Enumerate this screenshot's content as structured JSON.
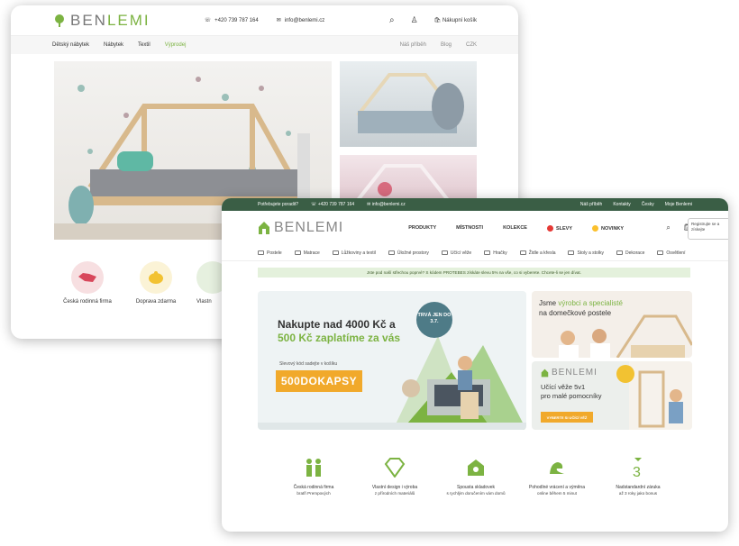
{
  "old_site": {
    "logo": {
      "prefix": "BEN",
      "suffix": "LEMI"
    },
    "phone": "+420 739 787 164",
    "email": "info@benlemi.cz",
    "cart_label": "Nákupní košík",
    "nav": [
      "Dětský nábytek",
      "Nábytek",
      "Textil",
      "Výprodej"
    ],
    "nav_right": [
      "Náš příběh",
      "Blog",
      "CZK"
    ],
    "features": [
      "Česká rodinná firma",
      "Doprava zdarma",
      "Vlastn"
    ]
  },
  "new_site": {
    "topbar": {
      "question": "Potřebujete poradit?",
      "phone": "+420 739 787 164",
      "email": "info@benlemi.cz",
      "links": [
        "Náš příběh",
        "Kontakty",
        "Česky",
        "Moje Benlemi"
      ]
    },
    "logo": "BENLEMI",
    "menu": [
      "PRODUKTY",
      "MÍSTNOSTI",
      "KOLEKCE",
      "SLEVY",
      "NOVINKY"
    ],
    "tooltip": "Registrujte se a získejte",
    "categories": [
      "Postele",
      "Matrace",
      "Lůžkoviny a textil",
      "Úložné prostory",
      "Učící věže",
      "Hračky",
      "Židle a křesla",
      "Stoly a stolky",
      "Dekorace",
      "Osvětlení"
    ],
    "notice": "Jste pod naší střechou poprvé? S kódem PROTEBES získáte slevu 5% na vše, co si vyberete. Chcete-li se jen dívat.",
    "banner": {
      "line1": "Nakupte nad 4000 Kč a",
      "line2": "500 Kč zaplatíme za vás",
      "code_label": "Slevový kód sadejte v košíku",
      "code": "500DOKAPSY",
      "badge": "TRVÁ JEN DO 3.7."
    },
    "promo_top": {
      "line1": "Jsme",
      "highlight": "výrobci a specialisté",
      "line2": "na domečkové postele"
    },
    "promo_bottom": {
      "logo": "BENLEMI",
      "line1": "Učící věže 5v1",
      "line2": "pro malé pomocníky",
      "button": "VYBERTE SI UČÍCÍ VĚŽ"
    },
    "features": [
      {
        "title": "Česká rodinná firma",
        "sub": "bratři Prempových"
      },
      {
        "title": "Vlastní design i výroba",
        "sub": "z přírodních materiálů"
      },
      {
        "title": "Spousta skladovek",
        "sub": "s rychlým doručením vám domů"
      },
      {
        "title": "Pohodlné vrácení a výměna",
        "sub": "online během 5 minut"
      },
      {
        "title": "Nadstandardní záruka",
        "sub": "až 3 roky jako bonus"
      }
    ]
  },
  "colors": {
    "brand_green": "#7cb342",
    "dark_green": "#3a5e45",
    "accent_orange": "#f1a92b"
  }
}
